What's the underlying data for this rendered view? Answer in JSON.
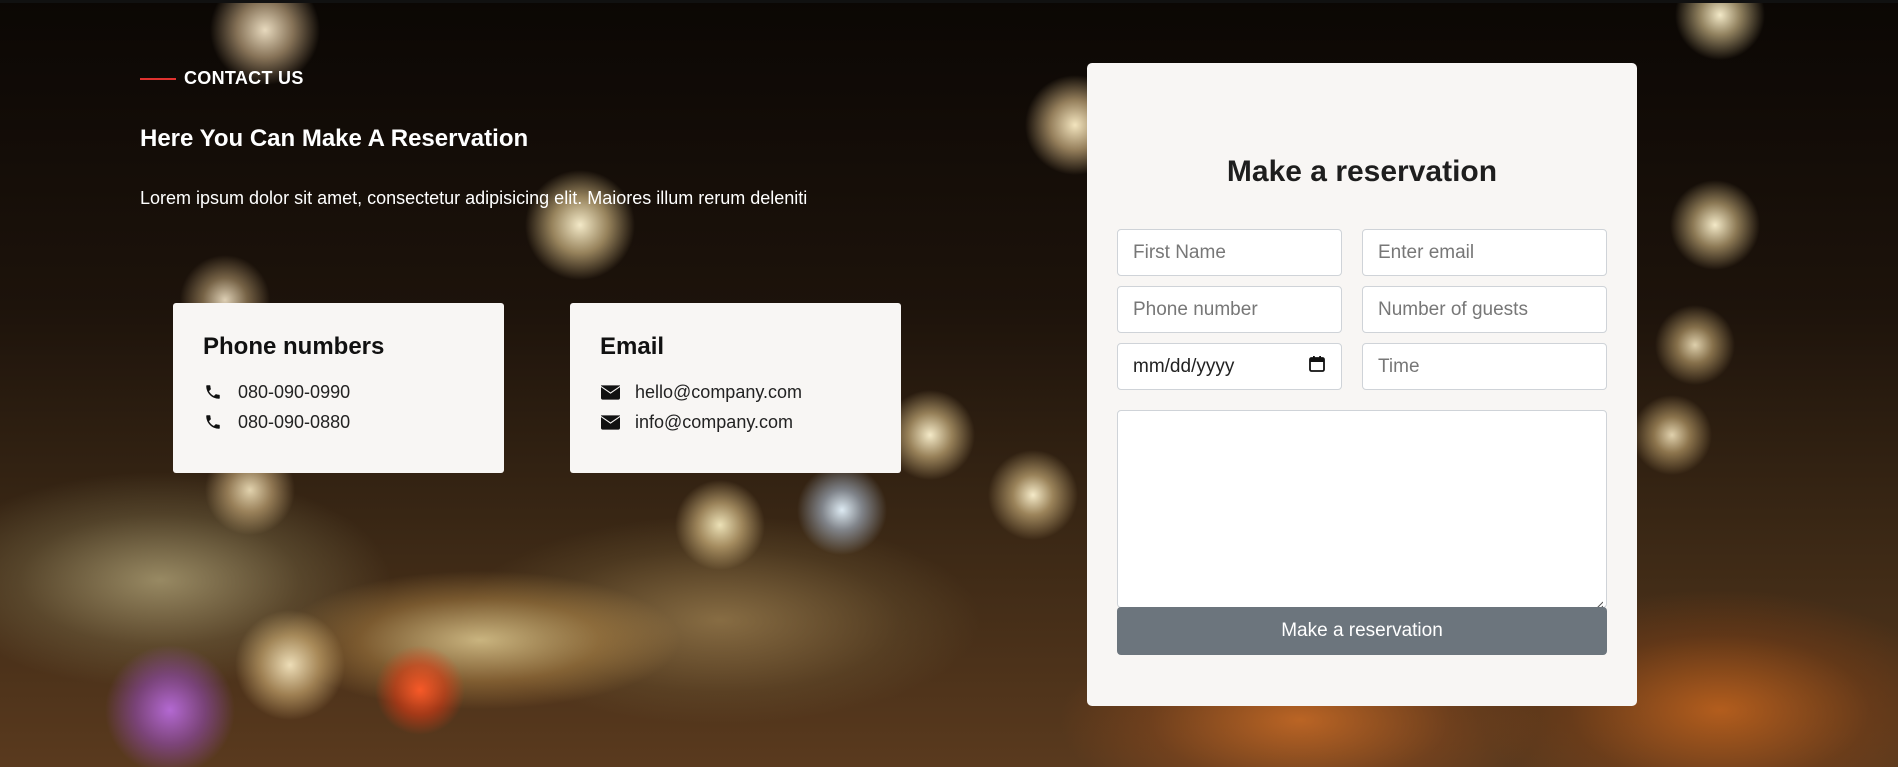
{
  "section": {
    "label": "CONTACT US",
    "heading": "Here You Can Make A Reservation",
    "lead": "Lorem ipsum dolor sit amet, consectetur adipisicing elit. Maiores illum rerum deleniti"
  },
  "phone_card": {
    "title": "Phone numbers",
    "icon": "phone-icon",
    "items": [
      "080-090-0990",
      "080-090-0880"
    ]
  },
  "email_card": {
    "title": "Email",
    "icon": "envelope-icon",
    "items": [
      "hello@company.com",
      "info@company.com"
    ]
  },
  "form": {
    "title": "Make a reservation",
    "first_name_placeholder": "First Name",
    "email_placeholder": "Enter email",
    "phone_placeholder": "Phone number",
    "guests_placeholder": "Number of guests",
    "date_value": "mm/dd/yyyy",
    "time_placeholder": "Time",
    "message_value": "",
    "submit_label": "Make a reservation"
  },
  "colors": {
    "accent_line": "#e0322f",
    "card_bg": "#f8f6f4",
    "button_bg": "#6c757d"
  }
}
